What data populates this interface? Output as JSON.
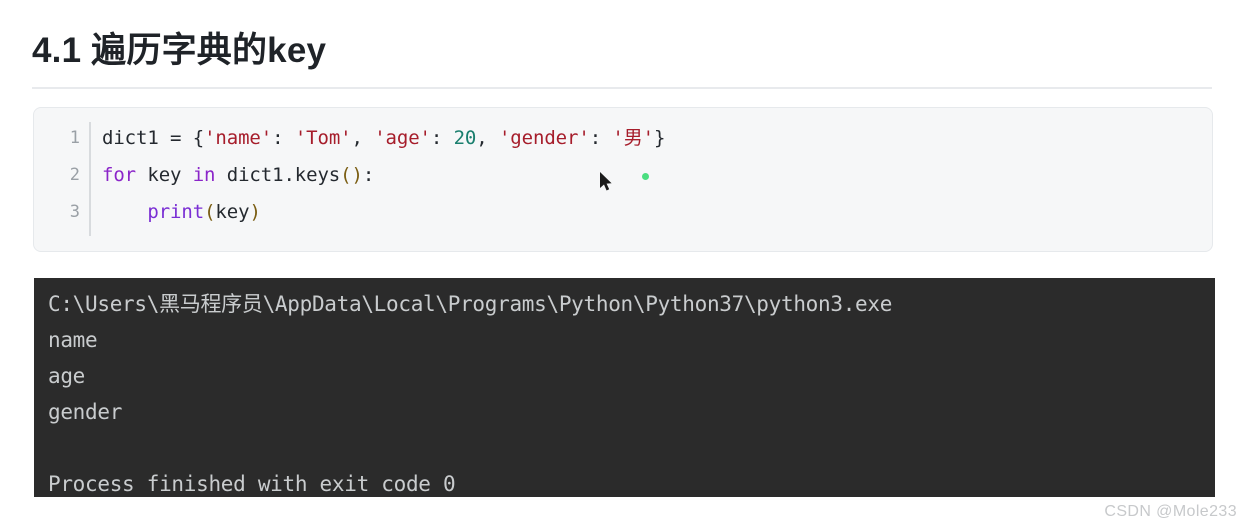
{
  "heading": {
    "text": "4.1 遍历字典的key"
  },
  "code_block": {
    "language": "python",
    "lines": [
      {
        "number": "1",
        "tokens": [
          {
            "text": "dict1 ",
            "type": "plain"
          },
          {
            "text": "= ",
            "type": "punct"
          },
          {
            "text": "{",
            "type": "punct"
          },
          {
            "text": "'name'",
            "type": "str"
          },
          {
            "text": ": ",
            "type": "punct"
          },
          {
            "text": "'Tom'",
            "type": "str"
          },
          {
            "text": ", ",
            "type": "punct"
          },
          {
            "text": "'age'",
            "type": "str"
          },
          {
            "text": ": ",
            "type": "punct"
          },
          {
            "text": "20",
            "type": "num"
          },
          {
            "text": ", ",
            "type": "punct"
          },
          {
            "text": "'gender'",
            "type": "str"
          },
          {
            "text": ": ",
            "type": "punct"
          },
          {
            "text": "'男'",
            "type": "str"
          },
          {
            "text": "}",
            "type": "punct"
          }
        ]
      },
      {
        "number": "2",
        "tokens": [
          {
            "text": "for ",
            "type": "kw"
          },
          {
            "text": "key ",
            "type": "plain"
          },
          {
            "text": "in ",
            "type": "kw"
          },
          {
            "text": "dict1.keys",
            "type": "plain"
          },
          {
            "text": "()",
            "type": "paren"
          },
          {
            "text": ":",
            "type": "punct"
          }
        ]
      },
      {
        "number": "3",
        "tokens": [
          {
            "text": "    ",
            "type": "plain"
          },
          {
            "text": "print",
            "type": "fn"
          },
          {
            "text": "(",
            "type": "paren"
          },
          {
            "text": "key",
            "type": "plain"
          },
          {
            "text": ")",
            "type": "paren"
          }
        ]
      }
    ]
  },
  "overlay": {
    "cursor_icon": "mouse-pointer-icon",
    "dot_color": "#4ade80"
  },
  "terminal": {
    "background": "#2b2b2b",
    "text_color": "#c9ccce",
    "lines": [
      "C:\\Users\\黑马程序员\\AppData\\Local\\Programs\\Python\\Python37\\python3.exe",
      "name",
      "age",
      "gender",
      "",
      "Process finished with exit code 0"
    ]
  },
  "watermark": {
    "text": "CSDN @Mole233"
  }
}
